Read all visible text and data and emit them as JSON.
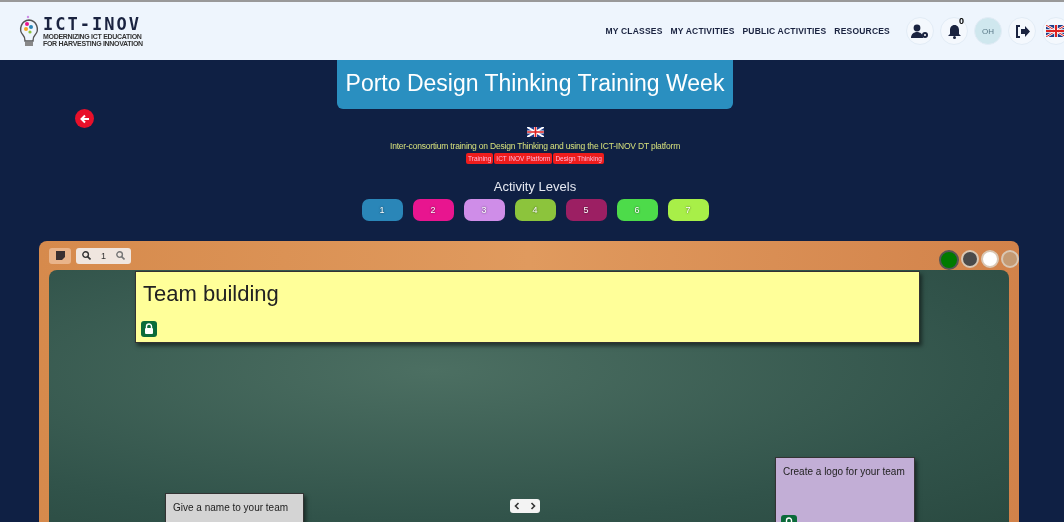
{
  "logo": {
    "name": "ICT-INOV",
    "tagline_1": "MODERNIZING ICT EDUCATION",
    "tagline_2": "FOR HARVESTING INNOVATION"
  },
  "nav": [
    "MY CLASSES",
    "MY ACTIVITIES",
    "PUBLIC ACTIVITIES",
    "RESOURCES"
  ],
  "notifications": {
    "count": "0"
  },
  "avatar": {
    "initials": "OH"
  },
  "activity": {
    "title": "Porto Design Thinking Training Week",
    "description": "Inter-consortium training on Design Thinking and using the ICT-INOV DT platform",
    "tags": [
      "Training",
      "ICT INOV Platform",
      "Design Thinking"
    ]
  },
  "levels": {
    "title": "Activity Levels",
    "items": [
      {
        "label": "1",
        "color": "#2a86b8"
      },
      {
        "label": "2",
        "color": "#e8158f"
      },
      {
        "label": "3",
        "color": "#cf8de8"
      },
      {
        "label": "4",
        "color": "#8cc43c"
      },
      {
        "label": "5",
        "color": "#9c1f63"
      },
      {
        "label": "6",
        "color": "#4ddb4a"
      },
      {
        "label": "7",
        "color": "#a8ef48"
      }
    ]
  },
  "board": {
    "zoom": "1",
    "backgrounds": [
      {
        "color": "#007a00",
        "selected": true
      },
      {
        "color": "#4a4a4a",
        "selected": false
      },
      {
        "color": "#ffffff",
        "selected": false
      },
      {
        "color": "#c49a73",
        "selected": false
      }
    ],
    "notes": [
      {
        "text": "Team building",
        "color": "#ffff99",
        "kind": "heading",
        "locked": true
      },
      {
        "text": "Give a name to your team",
        "color": "#d4d4d4",
        "kind": "task"
      },
      {
        "text": "Create a logo for your team",
        "color": "#c2aed6",
        "kind": "task",
        "locked": true
      }
    ]
  }
}
